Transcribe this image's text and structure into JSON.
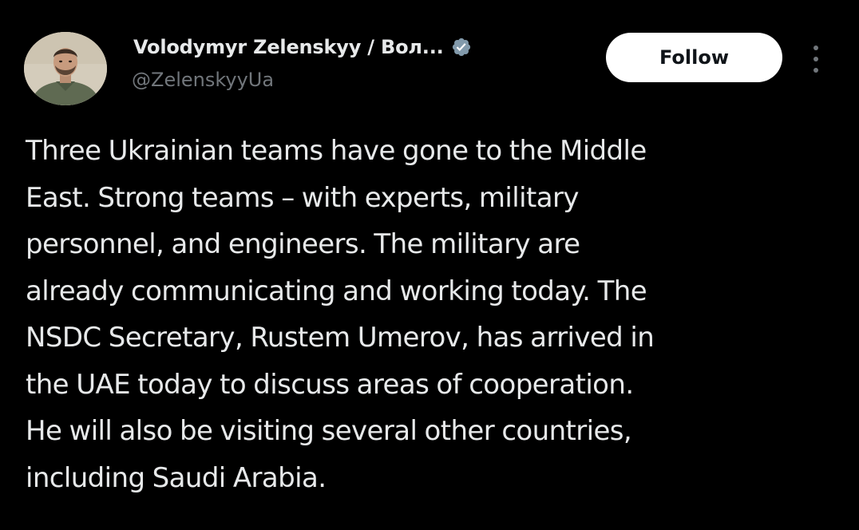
{
  "author": {
    "display_name": "Volodymyr Zelenskyy / Вол...",
    "handle": "@ZelenskyyUa",
    "avatar_icon": "profile-photo",
    "verified_icon": "verified-badge-icon",
    "verified_color": "#829aab"
  },
  "actions": {
    "follow_label": "Follow",
    "more_icon": "more-vertical-icon"
  },
  "tweet": {
    "lines": [
      "Three Ukrainian teams have gone to the Middle",
      "East. Strong teams – with experts, military",
      "personnel, and engineers. The military are",
      "already communicating and working today. The",
      "NSDC Secretary, Rustem Umerov, has arrived in",
      "the UAE today to discuss areas of cooperation.",
      "He will also be visiting several other countries,",
      "including Saudi Arabia."
    ]
  },
  "colors": {
    "background": "#000000",
    "text_primary": "#e7e9ea",
    "text_secondary": "#71767b",
    "button_background": "#ffffff",
    "button_text": "#0f1419"
  }
}
